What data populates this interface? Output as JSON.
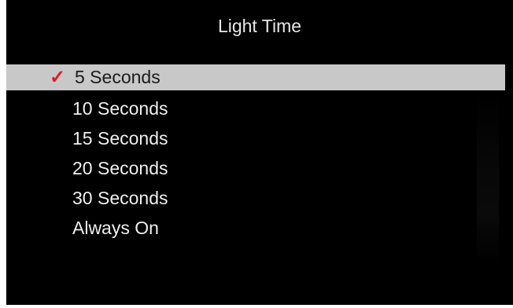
{
  "screen": {
    "title": "Light Time"
  },
  "menu": {
    "selected_index": 0,
    "check_icon": "check-icon",
    "accent_color": "#e21b22",
    "items": [
      {
        "label": "5 Seconds"
      },
      {
        "label": "10 Seconds"
      },
      {
        "label": "15 Seconds"
      },
      {
        "label": "20 Seconds"
      },
      {
        "label": "30 Seconds"
      },
      {
        "label": "Always On"
      }
    ]
  }
}
